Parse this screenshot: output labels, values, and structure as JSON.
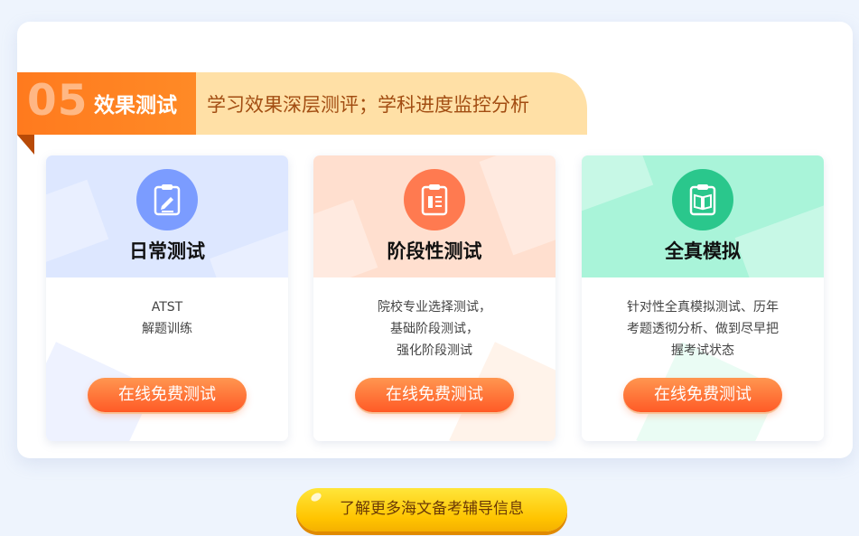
{
  "section": {
    "number": "05",
    "title": "效果测试",
    "subtitle": "学习效果深层测评；学科进度监控分析"
  },
  "cards": [
    {
      "icon": "clipboard-edit-icon",
      "title": "日常测试",
      "desc_lines": [
        "ATST",
        "解题训练"
      ],
      "button": "在线免费测试",
      "colors": {
        "top": "#dde7ff",
        "icon": "#7b9cff",
        "deco": "#e8eeff"
      }
    },
    {
      "icon": "clipboard-list-icon",
      "title": "阶段性测试",
      "desc_lines": [
        "院校专业选择测试，",
        "基础阶段测试，",
        "强化阶段测试"
      ],
      "button": "在线免费测试",
      "colors": {
        "top": "#ffdfcf",
        "icon": "#ff7a50",
        "deco": "#fff1e8"
      }
    },
    {
      "icon": "book-icon",
      "title": "全真模拟",
      "desc_lines": [
        "针对性全真模拟测试、历年",
        "考题透彻分析、做到尽早把",
        "握考试状态"
      ],
      "button": "在线免费测试",
      "colors": {
        "top": "#a9f4d9",
        "icon": "#2ac78c",
        "deco": "#e4fbf2"
      }
    }
  ],
  "cta": {
    "label": "了解更多海文备考辅导信息"
  }
}
